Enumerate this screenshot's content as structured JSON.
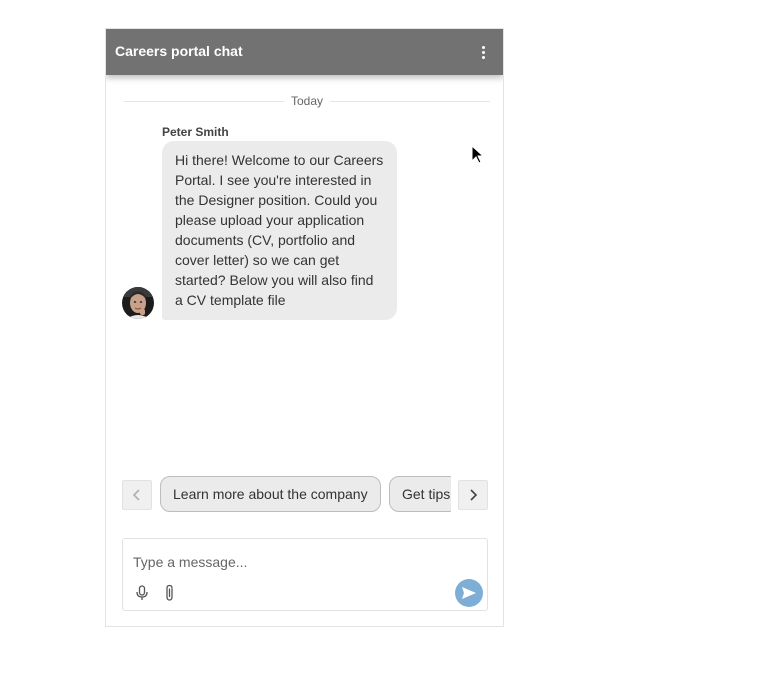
{
  "header": {
    "title": "Careers portal chat",
    "menu_icon": "more-vertical-icon"
  },
  "conversation": {
    "date_separator": "Today",
    "messages": [
      {
        "sender": "Peter Smith",
        "text": "Hi there! Welcome to our Careers Portal. I see you're interested in the Designer position. Could you please upload your application documents (CV, portfolio and cover letter) so we can get started? Below you will also find a CV template file",
        "avatar_icon": "avatar-photo"
      }
    ]
  },
  "quick_replies": {
    "prev_icon": "chevron-left-icon",
    "next_icon": "chevron-right-icon",
    "items": [
      {
        "label": "Learn more about the company"
      },
      {
        "label": "Get tips"
      }
    ]
  },
  "composer": {
    "placeholder": "Type a message...",
    "value": "",
    "mic_icon": "microphone-icon",
    "attach_icon": "paperclip-icon",
    "send_icon": "send-icon"
  },
  "colors": {
    "header_bg": "#727272",
    "bubble_bg": "#ebebeb",
    "send_button": "#7eaed6"
  }
}
